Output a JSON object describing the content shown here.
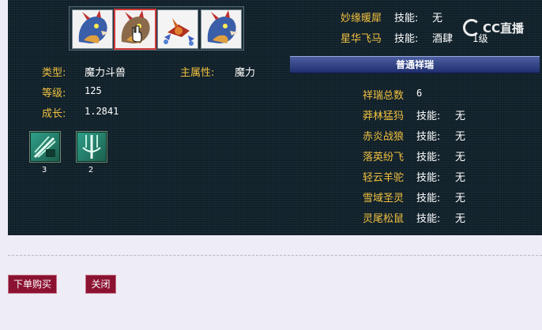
{
  "pets": [
    {
      "icon": "dragon-beast-icon",
      "active": false
    },
    {
      "icon": "dragon-beast-icon",
      "active": true
    },
    {
      "icon": "red-bird-icon",
      "active": false
    },
    {
      "icon": "dragon-beast-icon",
      "active": false
    }
  ],
  "info": {
    "type_label": "类型:",
    "type_value": "魔力斗兽",
    "attr_label": "主属性:",
    "attr_value": "魔力",
    "level_label": "等级:",
    "level_value": "125",
    "growth_label": "成长:",
    "growth_value": "1.2841"
  },
  "skills": [
    {
      "icon": "claw-skill-icon",
      "count": "3"
    },
    {
      "icon": "spear-skill-icon",
      "count": "2"
    }
  ],
  "top_rows": [
    {
      "name": "妙缘暖犀",
      "skill_label": "技能:",
      "skill_value": "无"
    },
    {
      "name": "星华飞马",
      "skill_label": "技能:",
      "skill_value": "酒肆",
      "extra": "1级"
    }
  ],
  "section_title": "普通祥瑞",
  "total": {
    "label": "祥瑞总数",
    "value": "6"
  },
  "mounts": [
    {
      "name": "莽林猛犸",
      "skill_label": "技能:",
      "skill_value": "无"
    },
    {
      "name": "赤炎战狼",
      "skill_label": "技能:",
      "skill_value": "无"
    },
    {
      "name": "落英纷飞",
      "skill_label": "技能:",
      "skill_value": "无"
    },
    {
      "name": "轻云羊驼",
      "skill_label": "技能:",
      "skill_value": "无"
    },
    {
      "name": "雪域圣灵",
      "skill_label": "技能:",
      "skill_value": "无"
    },
    {
      "name": "灵尾松鼠",
      "skill_label": "技能:",
      "skill_value": "无"
    }
  ],
  "watermark": {
    "text": "CC直播"
  },
  "buttons": {
    "buy": "下单购买",
    "close": "关闭"
  },
  "colors": {
    "gold": "#f0c040",
    "panel": "#12232d",
    "button": "#8b1230",
    "section": "#2a3c82"
  }
}
